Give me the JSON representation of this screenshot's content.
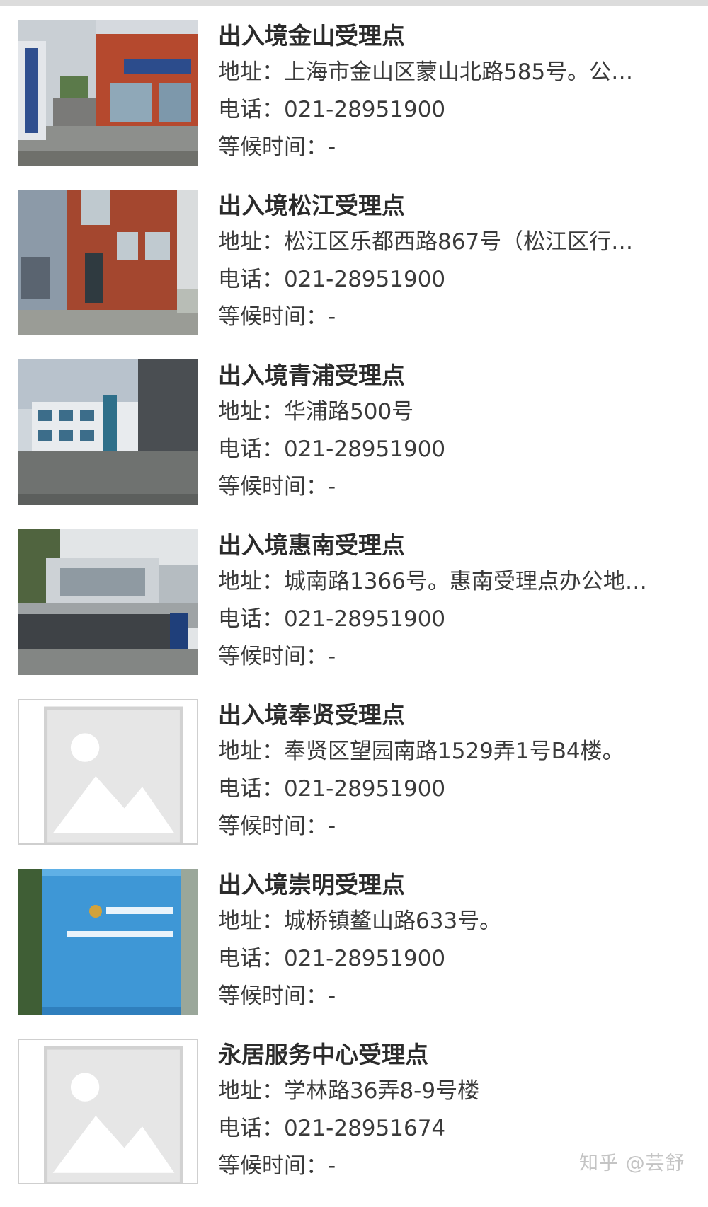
{
  "items": [
    {
      "title": "出入境金山受理点",
      "address": "地址：上海市金山区蒙山北路585号。公…",
      "phone": "电话：021-28951900",
      "wait": "等候时间：-",
      "image": "photo-jinshan-building"
    },
    {
      "title": "出入境松江受理点",
      "address": "地址：松江区乐都西路867号（松江区行…",
      "phone": "电话：021-28951900",
      "wait": "等候时间：-",
      "image": "photo-songjiang-building"
    },
    {
      "title": "出入境青浦受理点",
      "address": "地址：华浦路500号",
      "phone": "电话：021-28951900",
      "wait": "等候时间：-",
      "image": "photo-qingpu-building"
    },
    {
      "title": "出入境惠南受理点",
      "address": "地址：城南路1366号。惠南受理点办公地…",
      "phone": "电话：021-28951900",
      "wait": "等候时间：-",
      "image": "photo-huinan-tech-park"
    },
    {
      "title": "出入境奉贤受理点",
      "address": "地址：奉贤区望园南路1529弄1号B4楼。",
      "phone": "电话：021-28951900",
      "wait": "等候时间：-",
      "image": "image-placeholder-icon"
    },
    {
      "title": "出入境崇明受理点",
      "address": "地址：城桥镇鳌山路633号。",
      "phone": "电话：021-28951900",
      "wait": "等候时间：-",
      "image": "photo-chongming-sign"
    },
    {
      "title": "永居服务中心受理点",
      "address": "地址：学林路36弄8-9号楼",
      "phone": "电话：021-28951674",
      "wait": "等候时间：-",
      "image": "image-placeholder-icon"
    }
  ],
  "watermark": "知乎 @芸舒",
  "colors": {
    "title": "#2b2b2b",
    "text": "#3a3a3a",
    "placeholder_border": "#cfcfcf",
    "watermark": "#c4c4c4"
  }
}
